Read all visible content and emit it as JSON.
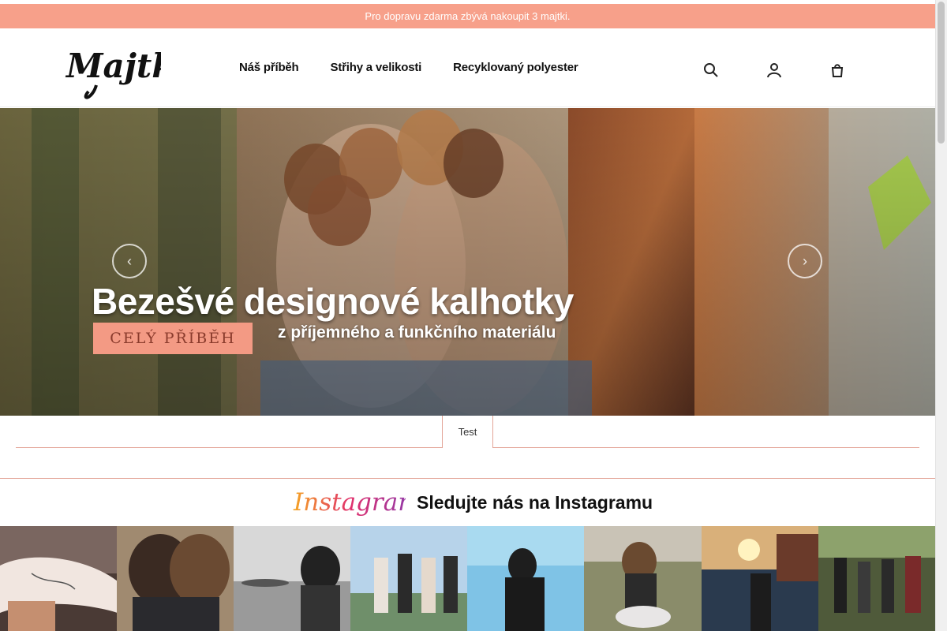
{
  "promo": {
    "text": "Pro dopravu zdarma zbývá nakoupit 3 majtki."
  },
  "brand": {
    "logo_text": "Majtki"
  },
  "nav": {
    "items": [
      {
        "label": "Náš příběh"
      },
      {
        "label": "Střihy a velikosti"
      },
      {
        "label": "Recyklovaný polyester"
      }
    ]
  },
  "header_icons": [
    "search-icon",
    "user-icon",
    "cart-icon"
  ],
  "hero": {
    "title": "Bezešvé designové kalhotky",
    "subtitle": "z příjemného a funkčního materiálu",
    "cta_label": "Celý příběh",
    "prev_icon": "chevron-left-icon",
    "next_icon": "chevron-right-icon"
  },
  "tabs": {
    "items": [
      {
        "label": "Test"
      }
    ]
  },
  "instagram": {
    "logo_text": "Instagram",
    "title": "Sledujte nás na Instagramu",
    "tiles": [
      {
        "name": "tattoo-underwear-photo"
      },
      {
        "name": "hug-back-photo"
      },
      {
        "name": "lake-bw-photo"
      },
      {
        "name": "group-railing-photo"
      },
      {
        "name": "sky-silhouette-photo"
      },
      {
        "name": "rocks-sitting-photo"
      },
      {
        "name": "sunset-rails-photo"
      },
      {
        "name": "forest-group-photo"
      }
    ]
  },
  "colors": {
    "accent": "#f7a08a",
    "line": "#e3a497"
  }
}
